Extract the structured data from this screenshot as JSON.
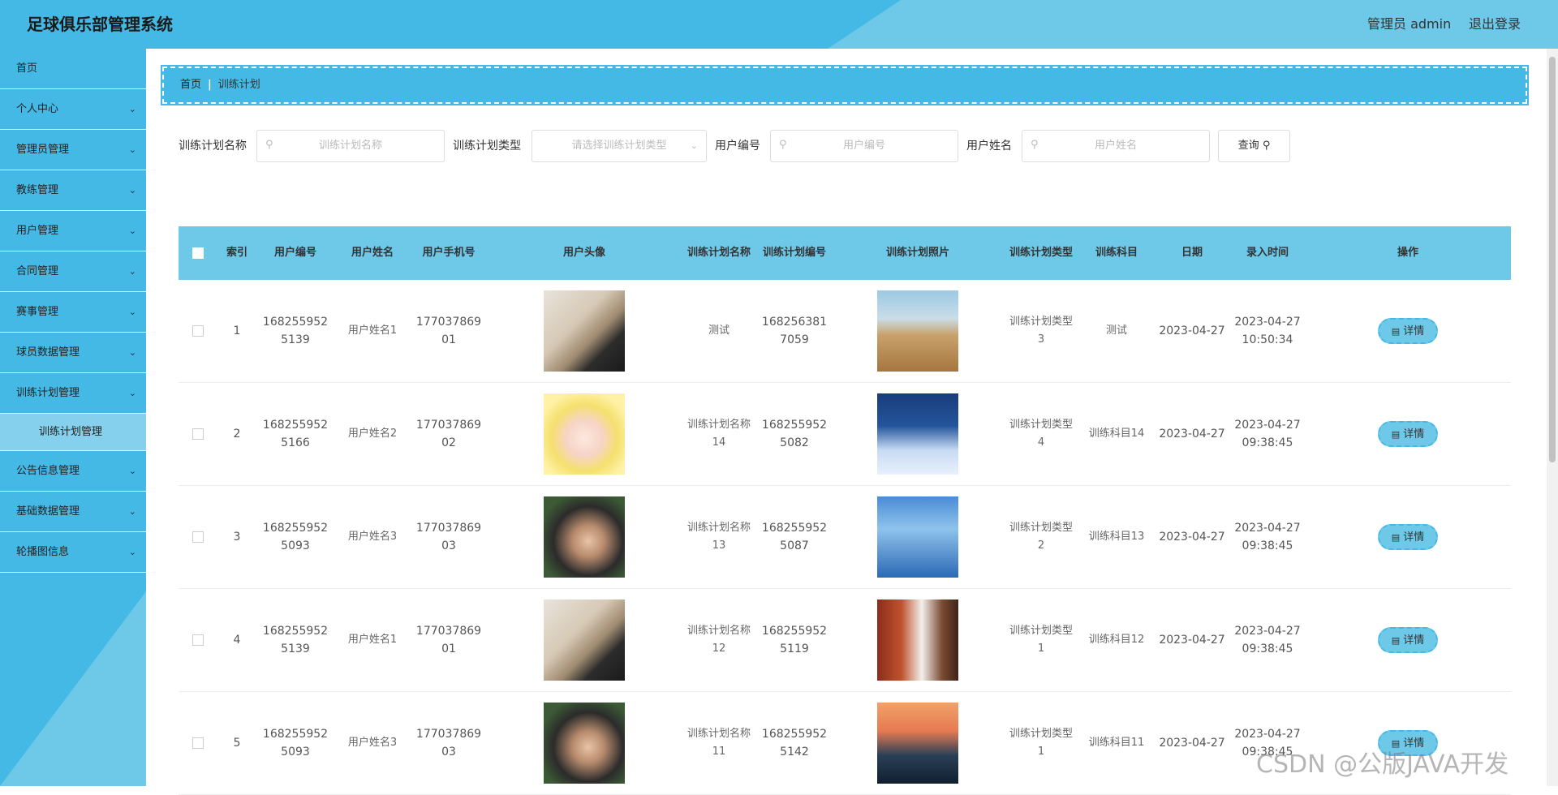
{
  "header": {
    "title": "足球俱乐部管理系统",
    "admin_label": "管理员 admin",
    "logout_label": "退出登录"
  },
  "sidebar": {
    "items": [
      {
        "label": "首页",
        "expandable": false
      },
      {
        "label": "个人中心",
        "expandable": true
      },
      {
        "label": "管理员管理",
        "expandable": true
      },
      {
        "label": "教练管理",
        "expandable": true
      },
      {
        "label": "用户管理",
        "expandable": true
      },
      {
        "label": "合同管理",
        "expandable": true
      },
      {
        "label": "赛事管理",
        "expandable": true
      },
      {
        "label": "球员数据管理",
        "expandable": true
      },
      {
        "label": "训练计划管理",
        "expandable": true
      }
    ],
    "sub_item": "训练计划管理",
    "items_after": [
      {
        "label": "公告信息管理"
      },
      {
        "label": "基础数据管理"
      },
      {
        "label": "轮播图信息"
      }
    ]
  },
  "breadcrumb": {
    "home": "首页",
    "current": "训练计划"
  },
  "search": {
    "plan_name_label": "训练计划名称",
    "plan_name_placeholder": "训练计划名称",
    "plan_type_label": "训练计划类型",
    "plan_type_placeholder": "请选择训练计划类型",
    "user_no_label": "用户编号",
    "user_no_placeholder": "用户编号",
    "user_name_label": "用户姓名",
    "user_name_placeholder": "用户姓名",
    "query_label": "查询"
  },
  "table": {
    "headers": [
      "索引",
      "用户编号",
      "用户姓名",
      "用户手机号",
      "用户头像",
      "训练计划名称",
      "训练计划编号",
      "训练计划照片",
      "训练计划类型",
      "训练科目",
      "日期",
      "录入时间",
      "操作"
    ],
    "detail_label": "详情",
    "rows": [
      {
        "index": "1",
        "user_no": "1682559525139",
        "user_name": "用户姓名1",
        "phone": "17703786901",
        "plan_name": "测试",
        "plan_no": "1682563817059",
        "plan_type": "训练计划类型3",
        "subject": "测试",
        "date": "2023-04-27",
        "created": "2023-04-27 10:50:34"
      },
      {
        "index": "2",
        "user_no": "1682559525166",
        "user_name": "用户姓名2",
        "phone": "17703786902",
        "plan_name": "训练计划名称14",
        "plan_no": "1682559525082",
        "plan_type": "训练计划类型4",
        "subject": "训练科目14",
        "date": "2023-04-27",
        "created": "2023-04-27 09:38:45"
      },
      {
        "index": "3",
        "user_no": "1682559525093",
        "user_name": "用户姓名3",
        "phone": "17703786903",
        "plan_name": "训练计划名称13",
        "plan_no": "1682559525087",
        "plan_type": "训练计划类型2",
        "subject": "训练科目13",
        "date": "2023-04-27",
        "created": "2023-04-27 09:38:45"
      },
      {
        "index": "4",
        "user_no": "1682559525139",
        "user_name": "用户姓名1",
        "phone": "17703786901",
        "plan_name": "训练计划名称12",
        "plan_no": "1682559525119",
        "plan_type": "训练计划类型1",
        "subject": "训练科目12",
        "date": "2023-04-27",
        "created": "2023-04-27 09:38:45"
      },
      {
        "index": "5",
        "user_no": "1682559525093",
        "user_name": "用户姓名3",
        "phone": "17703786903",
        "plan_name": "训练计划名称11",
        "plan_no": "1682559525142",
        "plan_type": "训练计划类型1",
        "subject": "训练科目11",
        "date": "2023-04-27",
        "created": "2023-04-27 09:38:45"
      }
    ]
  },
  "watermark": "CSDN @公版JAVA开发"
}
